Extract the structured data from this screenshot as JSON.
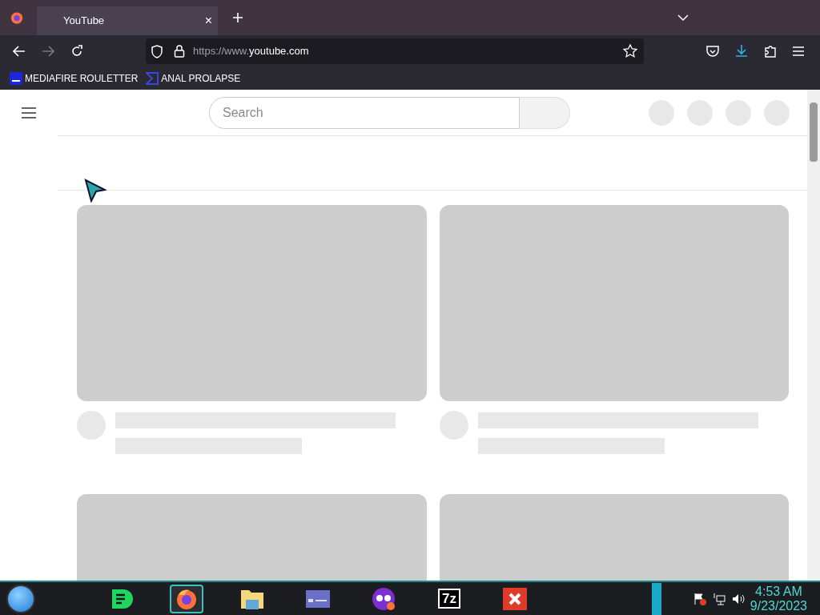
{
  "tabs": [
    {
      "title": "YouTube",
      "close": "×",
      "selected": true
    }
  ],
  "address": {
    "scheme": "https://www.",
    "host": "youtube.com"
  },
  "bookmarks": [
    {
      "label": "MEDIAFIRE ROULETTER",
      "kind": "mf"
    },
    {
      "label": "ANAL PROLAPSE",
      "kind": "sigma"
    }
  ],
  "page": {
    "search_placeholder": "Search"
  },
  "taskbar": {
    "apps": [
      {
        "kind": "notes",
        "selected": false
      },
      {
        "kind": "firefox",
        "selected": true
      },
      {
        "kind": "folder",
        "selected": false
      },
      {
        "kind": "card",
        "selected": false
      },
      {
        "kind": "mask",
        "selected": false
      },
      {
        "kind": "zip",
        "label": "7z",
        "selected": false
      },
      {
        "kind": "x",
        "selected": false
      }
    ],
    "time": "4:53 AM",
    "date": "9/23/2023"
  }
}
